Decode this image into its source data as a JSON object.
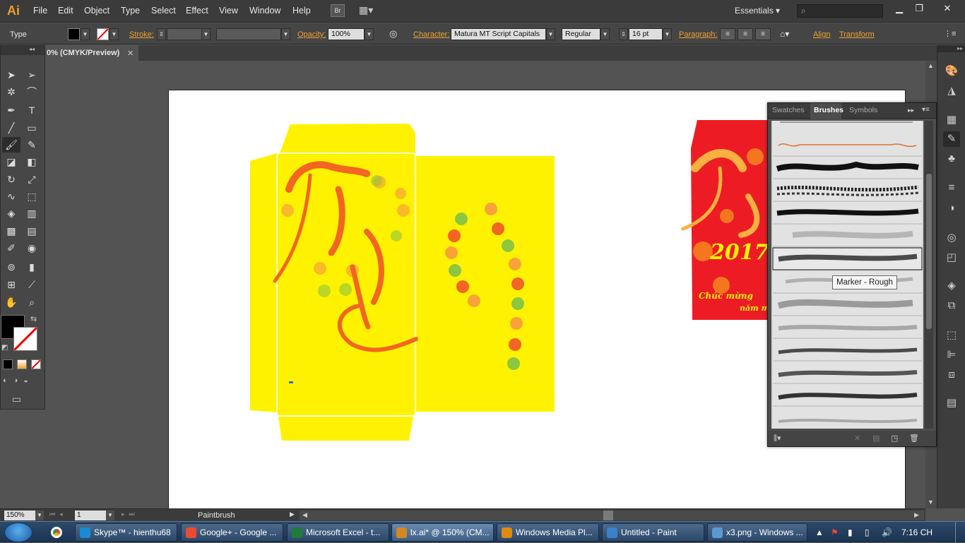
{
  "menubar": {
    "logo": "Ai",
    "items": [
      "File",
      "Edit",
      "Object",
      "Type",
      "Select",
      "Effect",
      "View",
      "Window",
      "Help"
    ],
    "bridge": "Br",
    "workspace": "Essentials",
    "search_placeholder": ""
  },
  "control": {
    "tool_label": "Type",
    "stroke_label": "Stroke:",
    "opacity_label": "Opacity:",
    "opacity_value": "100%",
    "character_label": "Character:",
    "font_family": "Matura MT Script Capitals",
    "font_style": "Regular",
    "font_size": "16 pt",
    "paragraph_label": "Paragraph:",
    "align_label": "Align",
    "transform_label": "Transform"
  },
  "document": {
    "tab_title": "0% (CMYK/Preview)",
    "zoom": "150%",
    "page": "1",
    "current_tool": "Paintbrush"
  },
  "brushes_panel": {
    "tabs": [
      "Swatches",
      "Brushes",
      "Symbols"
    ],
    "active_tab": "Brushes",
    "tooltip": "Marker - Rough"
  },
  "artwork": {
    "red_text_year": "2017",
    "red_text_greeting": "Chúc mừng",
    "red_text_line2": "năm m"
  },
  "taskbar": {
    "items": [
      {
        "label": "Skype™ - hienthu68",
        "color": "#1a8ad4"
      },
      {
        "label": "Google+ - Google ...",
        "color": "#e94b35"
      },
      {
        "label": "Microsoft Excel - t...",
        "color": "#1f7a3e"
      },
      {
        "label": "lx.ai* @ 150% (CM...",
        "color": "#d28a20"
      },
      {
        "label": "Windows Media Pl...",
        "color": "#e08a10"
      },
      {
        "label": "Untitled - Paint",
        "color": "#3a82c8"
      },
      {
        "label": "x3.png - Windows ...",
        "color": "#5a9ad0"
      }
    ],
    "clock": "7:16 CH"
  },
  "colors": {
    "yellow": "#fff200",
    "orange": "#f26522",
    "red": "#ed1c24",
    "ui_accent": "#f0a030"
  }
}
